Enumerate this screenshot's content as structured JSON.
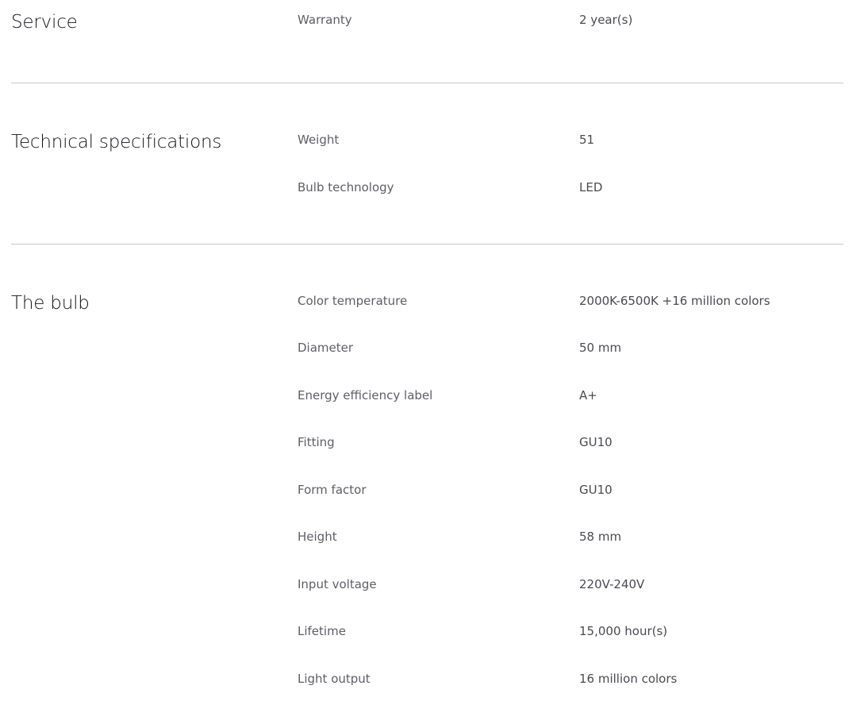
{
  "sections": [
    {
      "title": "Service",
      "rows": [
        {
          "label": "Warranty",
          "value": "2 year(s)"
        }
      ]
    },
    {
      "title": "Technical specifications",
      "rows": [
        {
          "label": "Weight",
          "value": "51"
        },
        {
          "label": "Bulb technology",
          "value": "LED"
        }
      ]
    },
    {
      "title": "The bulb",
      "rows": [
        {
          "label": "Color temperature",
          "value": "2000K-6500K +16 million colors"
        },
        {
          "label": "Diameter",
          "value": "50 mm"
        },
        {
          "label": "Energy efficiency label",
          "value": "A+"
        },
        {
          "label": "Fitting",
          "value": "GU10"
        },
        {
          "label": "Form factor",
          "value": "GU10"
        },
        {
          "label": "Height",
          "value": "58 mm"
        },
        {
          "label": "Input voltage",
          "value": "220V-240V"
        },
        {
          "label": "Lifetime",
          "value": "15,000 hour(s)"
        },
        {
          "label": "Light output",
          "value": "16 million colors"
        }
      ]
    }
  ]
}
